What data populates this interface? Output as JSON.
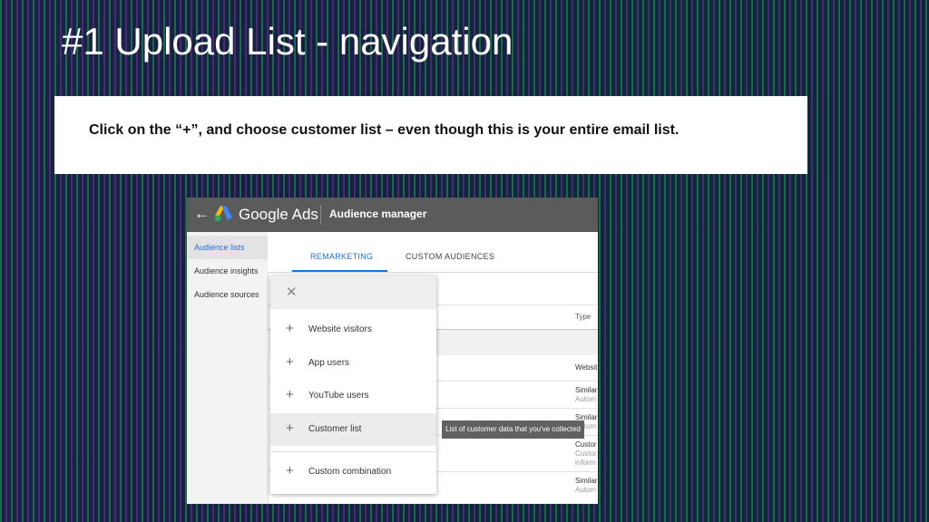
{
  "slide": {
    "title": "#1 Upload List - navigation",
    "instruction": "Click on the “+”, and choose customer list – even though this is your entire email list."
  },
  "app": {
    "back_icon": "arrow-left-icon",
    "brand": "Google Ads",
    "tool": "Audience manager",
    "accent_color": "#1a73e8"
  },
  "sidebar": {
    "items": [
      {
        "label": "Audience lists",
        "active": true
      },
      {
        "label": "Audience insights",
        "active": false
      },
      {
        "label": "Audience sources",
        "active": false
      }
    ]
  },
  "tabs": [
    {
      "label": "REMARKETING",
      "active": true
    },
    {
      "label": "CUSTOM AUDIENCES",
      "active": false
    }
  ],
  "table": {
    "type_header": "Type",
    "rows": [
      {
        "type": "Websit",
        "sub": ""
      },
      {
        "type": "Similar",
        "sub": "Autom"
      },
      {
        "type": "Similar",
        "sub": "Autom"
      },
      {
        "type": "Custor",
        "sub": "Custor",
        "sub2": "inform"
      },
      {
        "type": "Similar",
        "sub": "Autom"
      }
    ]
  },
  "menu": {
    "close_icon": "close-icon",
    "items": [
      {
        "label": "Website visitors"
      },
      {
        "label": "App users"
      },
      {
        "label": "YouTube users"
      },
      {
        "label": "Customer list"
      },
      {
        "label": "Custom combination"
      }
    ]
  },
  "tooltip": "List of customer data that you've collected"
}
